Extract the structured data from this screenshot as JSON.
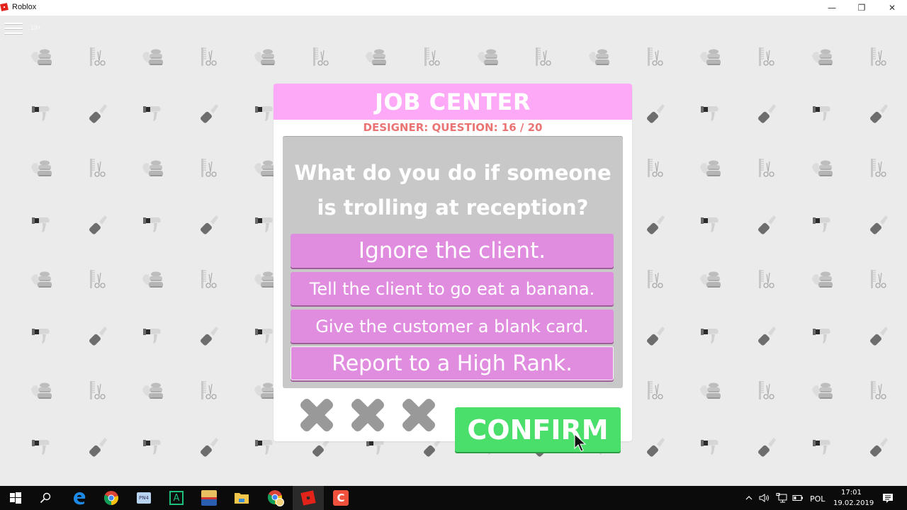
{
  "window": {
    "title": "Roblox",
    "controls": {
      "minimize": "—",
      "maximize": "❐",
      "close": "✕"
    }
  },
  "game": {
    "age_badge": "13+",
    "background_pattern": [
      "spa-stones",
      "comb-scissors",
      "hair-dryer",
      "lipstick"
    ],
    "job_center": {
      "title": "JOB CENTER",
      "subtitle": "DESIGNER: QUESTION: 16 / 20",
      "job": "DESIGNER",
      "question_number": 16,
      "question_total": 20,
      "question": "What do you do if someone is trolling at reception?",
      "options": [
        {
          "label": "Ignore the client.",
          "selected": false
        },
        {
          "label": "Tell the client to go eat a banana.",
          "selected": false
        },
        {
          "label": "Give the customer a blank card.",
          "selected": false
        },
        {
          "label": "Report to a High Rank.",
          "selected": true
        }
      ],
      "strikes": {
        "count": 3,
        "used": 0
      },
      "confirm_label": "CONFIRM"
    },
    "colors": {
      "header_pink": "#fea8f8",
      "subtitle_red": "#ea7474",
      "option_pink": "#e08ddf",
      "question_gray": "#c8c8c8",
      "confirm_green": "#4ade6b",
      "strike_gray": "#999999"
    }
  },
  "taskbar": {
    "apps": [
      {
        "name": "start",
        "icon": "windows-icon"
      },
      {
        "name": "search",
        "icon": "search-icon"
      },
      {
        "name": "edge",
        "icon": "edge-icon"
      },
      {
        "name": "chrome",
        "icon": "chrome-icon"
      },
      {
        "name": "pn4",
        "icon": "pn4-icon",
        "label": "PN4"
      },
      {
        "name": "a-app",
        "icon": "a-app-icon",
        "label": "A"
      },
      {
        "name": "game-app",
        "icon": "game-app-icon"
      },
      {
        "name": "file-explorer",
        "icon": "folder-icon"
      },
      {
        "name": "chrome-profile",
        "icon": "chrome-profile-icon"
      },
      {
        "name": "roblox",
        "icon": "roblox-icon",
        "active": true
      },
      {
        "name": "c-app",
        "icon": "c-app-icon",
        "label": "C"
      }
    ],
    "tray": {
      "language": "POL",
      "time": "17:01",
      "date": "19.02.2019"
    }
  }
}
